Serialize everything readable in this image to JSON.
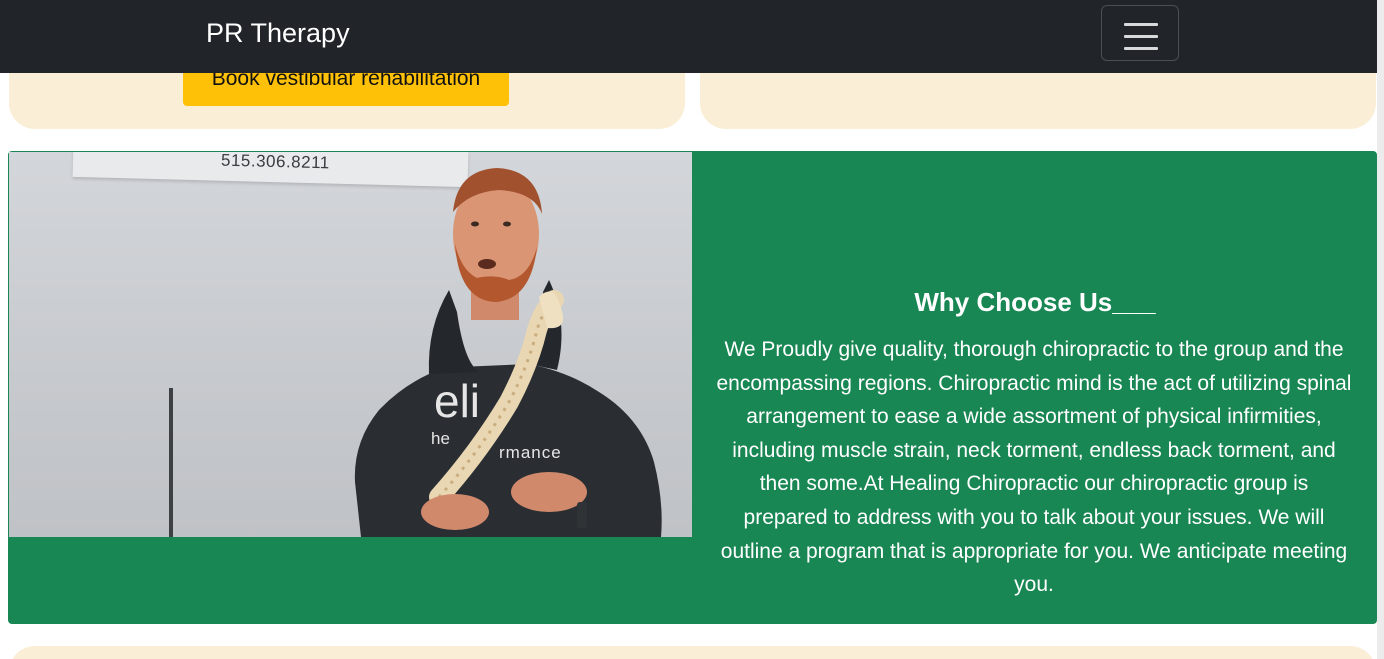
{
  "navbar": {
    "brand": "PR Therapy",
    "toggler_icon": "hamburger-menu-icon"
  },
  "top_cards": {
    "book_button_label": "Book vestibular rehabilitation"
  },
  "photo": {
    "banner_text": "515.306.8211",
    "hoodie_text": [
      "eli",
      "he",
      "rmance"
    ],
    "alt": ""
  },
  "why_section": {
    "title": "Why Choose Us___",
    "body": "We Proudly give quality, thorough chiropractic to the group and the encompassing regions. Chiropractic mind is the act of utilizing spinal arrangement to ease a wide assortment of physical infirmities, including muscle strain, neck torment, endless back torment, and then some.At Healing Chiropractic our chiropractic group is prepared to address with you to talk about your issues. We will outline a program that is appropriate for you. We anticipate meeting you."
  },
  "colors": {
    "navbar_bg": "#212529",
    "card_bg": "#fbeed6",
    "button_bg": "#ffc107",
    "section_bg": "#198754"
  }
}
